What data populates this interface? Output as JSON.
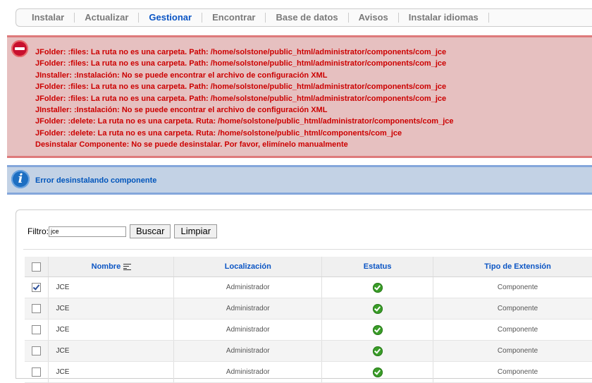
{
  "submenu": {
    "tabs": [
      {
        "label": "Instalar",
        "active": false
      },
      {
        "label": "Actualizar",
        "active": false
      },
      {
        "label": "Gestionar",
        "active": true
      },
      {
        "label": "Encontrar",
        "active": false
      },
      {
        "label": "Base de datos",
        "active": false
      },
      {
        "label": "Avisos",
        "active": false
      },
      {
        "label": "Instalar idiomas",
        "active": false
      }
    ]
  },
  "error": {
    "icon": "error-minus-icon",
    "messages": [
      "JFolder: :files: La ruta no es una carpeta. Path: /home/solstone/public_html/administrator/components/com_jce",
      "JFolder: :files: La ruta no es una carpeta. Path: /home/solstone/public_html/administrator/components/com_jce",
      "JInstaller: :Instalación: No se puede encontrar el archivo de configuración XML",
      "JFolder: :files: La ruta no es una carpeta. Path: /home/solstone/public_html/administrator/components/com_jce",
      "JFolder: :files: La ruta no es una carpeta. Path: /home/solstone/public_html/administrator/components/com_jce",
      "JInstaller: :Instalación: No se puede encontrar el archivo de configuración XML",
      "JFolder: :delete: La ruta no es una carpeta. Ruta: /home/solstone/public_html/administrator/components/com_jce",
      "JFolder: :delete: La ruta no es una carpeta. Ruta: /home/solstone/public_html/components/com_jce",
      "Desinstalar Componente: No se puede desinstalar. Por favor, elimínelo manualmente"
    ]
  },
  "notice": {
    "icon": "info-icon",
    "text": "Error desinstalando componente"
  },
  "filter": {
    "label": "Filtro:",
    "value": "jce",
    "search_label": "Buscar",
    "reset_label": "Limpiar"
  },
  "table": {
    "headers": {
      "name": "Nombre",
      "location": "Localización",
      "status": "Estatus",
      "type": "Tipo de Extensión"
    },
    "rows": [
      {
        "checked": true,
        "name": "JCE",
        "location": "Administrador",
        "status": "enabled",
        "type": "Componente"
      },
      {
        "checked": false,
        "name": "JCE",
        "location": "Administrador",
        "status": "enabled",
        "type": "Componente"
      },
      {
        "checked": false,
        "name": "JCE",
        "location": "Administrador",
        "status": "enabled",
        "type": "Componente"
      },
      {
        "checked": false,
        "name": "JCE",
        "location": "Administrador",
        "status": "enabled",
        "type": "Componente"
      },
      {
        "checked": false,
        "name": "JCE",
        "location": "Administrador",
        "status": "enabled",
        "type": "Componente"
      }
    ]
  }
}
